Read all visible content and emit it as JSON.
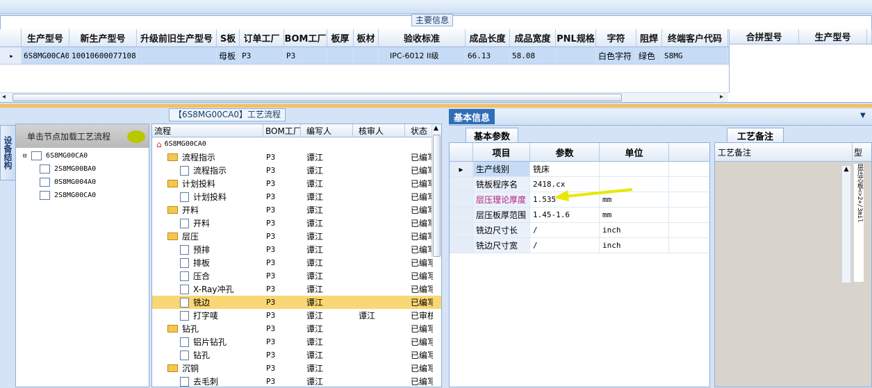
{
  "top": {
    "section_title": "主要信息"
  },
  "main_grid": {
    "headers": [
      "生产型号",
      "新生产型号",
      "升级前旧生产型号",
      "S板",
      "订单工厂",
      "BOM工厂",
      "板厚",
      "板材",
      "验收标准",
      "成品长度",
      "成品宽度",
      "PNL规格",
      "字符",
      "阻焊",
      "终端客户代码"
    ],
    "row": [
      "6S8MG00CA0",
      "10010600077108",
      "",
      "母板",
      "P3",
      "P3",
      "",
      "",
      "IPC-6012 II级",
      "66.13",
      "58.08",
      "",
      "白色字符",
      "绿色",
      "S8MG"
    ]
  },
  "side_grid": {
    "headers": [
      "合拼型号",
      "生产型号"
    ]
  },
  "left_panel": {
    "vertical_tab": "设备结构",
    "header": "单击节点加载工艺流程",
    "tree": [
      "6S8MG00CA0",
      "2S8MG00BA0",
      "0S8MG004A0",
      "2S8MG00CA0"
    ]
  },
  "flow_panel": {
    "title": "【6S8MG00CA0】工艺流程",
    "headers": [
      "流程",
      "BOM工厂",
      "编写人",
      "核审人",
      "状态"
    ],
    "rows": [
      {
        "name": "6S8MG00CA0",
        "bom": "",
        "writer": "",
        "checker": "",
        "status": ""
      },
      {
        "name": "流程指示",
        "bom": "P3",
        "writer": "谭江",
        "checker": "",
        "status": "已编写"
      },
      {
        "name": "流程指示",
        "bom": "P3",
        "writer": "谭江",
        "checker": "",
        "status": "已编写"
      },
      {
        "name": "计划投料",
        "bom": "P3",
        "writer": "谭江",
        "checker": "",
        "status": "已编写"
      },
      {
        "name": "计划投料",
        "bom": "P3",
        "writer": "谭江",
        "checker": "",
        "status": "已编写"
      },
      {
        "name": "开料",
        "bom": "P3",
        "writer": "谭江",
        "checker": "",
        "status": "已编写"
      },
      {
        "name": "开料",
        "bom": "P3",
        "writer": "谭江",
        "checker": "",
        "status": "已编写"
      },
      {
        "name": "层压",
        "bom": "P3",
        "writer": "谭江",
        "checker": "",
        "status": "已编写"
      },
      {
        "name": "预排",
        "bom": "P3",
        "writer": "谭江",
        "checker": "",
        "status": "已编写"
      },
      {
        "name": "排板",
        "bom": "P3",
        "writer": "谭江",
        "checker": "",
        "status": "已编写"
      },
      {
        "name": "压合",
        "bom": "P3",
        "writer": "谭江",
        "checker": "",
        "status": "已编写"
      },
      {
        "name": "X-Ray冲孔",
        "bom": "P3",
        "writer": "谭江",
        "checker": "",
        "status": "已编写"
      },
      {
        "name": "铣边",
        "bom": "P3",
        "writer": "谭江",
        "checker": "",
        "status": "已编写"
      },
      {
        "name": "打字唛",
        "bom": "P3",
        "writer": "谭江",
        "checker": "谭江",
        "status": "已审核"
      },
      {
        "name": "钻孔",
        "bom": "P3",
        "writer": "谭江",
        "checker": "",
        "status": "已编写"
      },
      {
        "name": "铝片钻孔",
        "bom": "P3",
        "writer": "谭江",
        "checker": "",
        "status": "已编写"
      },
      {
        "name": "钻孔",
        "bom": "P3",
        "writer": "谭江",
        "checker": "",
        "status": "已编写"
      },
      {
        "name": "沉铜",
        "bom": "P3",
        "writer": "谭江",
        "checker": "",
        "status": "已编写"
      },
      {
        "name": "去毛刺",
        "bom": "P3",
        "writer": "谭江",
        "checker": "",
        "status": "已编写"
      }
    ]
  },
  "right": {
    "tab_basic": "基本信息",
    "tab_params": "基本参数",
    "param_headers": [
      "项目",
      "参数",
      "单位"
    ],
    "params": [
      {
        "item": "生产线别",
        "value": "铣床",
        "unit": ""
      },
      {
        "item": "铣板程序名",
        "value": "2418.cx",
        "unit": ""
      },
      {
        "item": "层压理论厚度",
        "value": "1.535",
        "unit": "mm"
      },
      {
        "item": "层压板厚范围",
        "value": "1.45-1.6",
        "unit": "mm"
      },
      {
        "item": "铣边尺寸长",
        "value": "/",
        "unit": "inch"
      },
      {
        "item": "铣边尺寸宽",
        "value": "/",
        "unit": "inch"
      }
    ],
    "notes_tab": "工艺备注",
    "notes_header": "工艺备注",
    "notes_type_header": "型",
    "notes_side_text": "层压芯板<>2+/3mil"
  }
}
